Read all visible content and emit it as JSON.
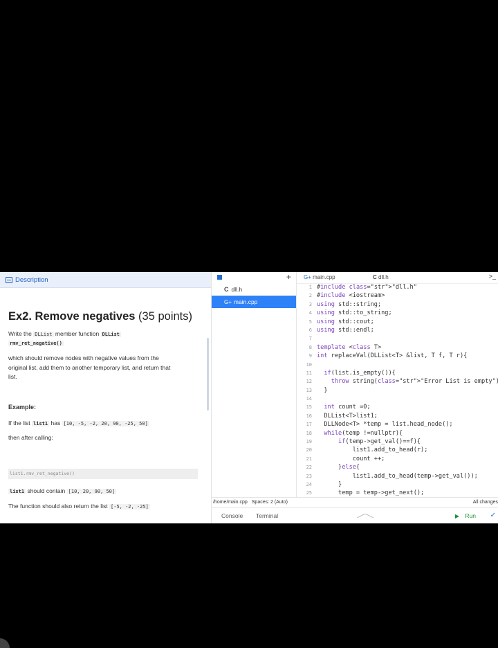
{
  "description_tab": {
    "label": "Description"
  },
  "problem": {
    "title": "Ex2. Remove negatives",
    "points": "(35 points)",
    "intro_prefix": "Write the",
    "intro_class": "DLList",
    "intro_mid": "member function",
    "intro_class2": "DLList",
    "intro_func": "rmv_ret_negative()",
    "body_line1": "which should remove nodes with negative values from the",
    "body_line2": "original list, add them to another temporary list, and return that",
    "body_line3": "list.",
    "example_heading": "Example:",
    "example_text1": "If the list",
    "example_list_name": "list1",
    "example_text2": "has",
    "example_list_values": "[10, -5, -2, 20, 90, -25, 50]",
    "then_text": "then after calling:",
    "call_code": "list1.rmv_ret_negative()",
    "result_list_name": "list1",
    "result_text": "should contain",
    "result_values": "[10, 20, 90, 50]",
    "return_text": "The function should also return the list",
    "return_values": "[-5, -2, -25]"
  },
  "file_tree": {
    "plus": "+",
    "files": [
      {
        "icon": "C",
        "name": "dll.h"
      },
      {
        "icon": "G+",
        "name": "main.cpp"
      }
    ]
  },
  "editor": {
    "tabs": [
      {
        "icon": "G+",
        "name": "main.cpp"
      },
      {
        "icon": "C",
        "name": "dll.h"
      }
    ],
    "expand": ">_",
    "line_numbers": [
      "1",
      "2",
      "3",
      "4",
      "5",
      "6",
      "7",
      "8",
      "9",
      "10",
      "11",
      "12",
      "13",
      "14",
      "15",
      "16",
      "17",
      "18",
      "19",
      "20",
      "21",
      "22",
      "23",
      "24",
      "25"
    ],
    "lines": [
      "#include \"dll.h\"",
      "#include <iostream>",
      "using std::string;",
      "using std::to_string;",
      "using std::cout;",
      "using std::endl;",
      "",
      "template <class T>",
      "int replaceVal(DLList<T> &list, T f, T r){",
      "",
      "  if(list.is_empty()){",
      "    throw string(\"Error List is empty\");",
      "  }",
      "",
      "  int count =0;",
      "  DLList<T>list1;",
      "  DLLNode<T> *temp = list.head_node();",
      "  while(temp !=nullptr){",
      "      if(temp->get_val()==f){",
      "          list1.add_to_head(r);",
      "          count ++;",
      "      }else{",
      "          list1.add_to_head(temp->get_val());",
      "      }",
      "      temp = temp->get_next();"
    ]
  },
  "status": {
    "path": "/home/main.cpp",
    "spaces": "Spaces: 2 (Auto)",
    "changes": "All changes"
  },
  "bottom": {
    "console": "Console",
    "terminal": "Terminal",
    "run": "Run"
  }
}
